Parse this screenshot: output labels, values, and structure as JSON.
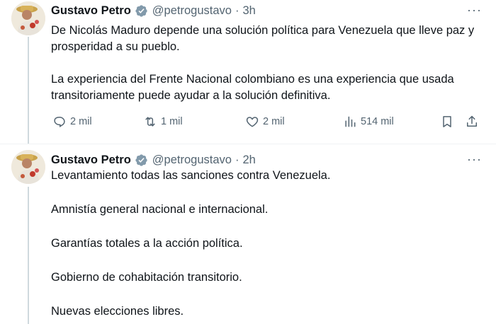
{
  "tweets": [
    {
      "author_name": "Gustavo Petro",
      "handle": "@petrogustavo",
      "separator": "·",
      "time": "3h",
      "more_label": "···",
      "paragraphs": [
        "De Nicolás Maduro depende una solución política para Venezuela que lleve paz y prosperidad a su pueblo.",
        "La experiencia del Frente Nacional colombiano es una experiencia que usada transitoriamente puede ayudar a la solución definitiva."
      ],
      "stats": {
        "replies": "2 mil",
        "reposts": "1 mil",
        "likes": "2 mil",
        "views": "514 mil"
      }
    },
    {
      "author_name": "Gustavo Petro",
      "handle": "@petrogustavo",
      "separator": "·",
      "time": "2h",
      "more_label": "···",
      "paragraphs": [
        "Levantamiento todas las sanciones contra Venezuela.",
        "Amnistía general nacional e internacional.",
        "Garantías totales a la acción política.",
        "Gobierno de cohabitación transitorio.",
        "Nuevas elecciones libres."
      ]
    }
  ],
  "icons": {
    "verified": "verified-badge-icon",
    "reply": "reply-icon",
    "repost": "repost-icon",
    "like": "heart-icon",
    "views": "views-icon",
    "bookmark": "bookmark-icon",
    "share": "share-icon"
  },
  "colors": {
    "text": "#0f1419",
    "secondary": "#536471",
    "verified": "#829aab",
    "thread_line": "#cfd9de"
  }
}
